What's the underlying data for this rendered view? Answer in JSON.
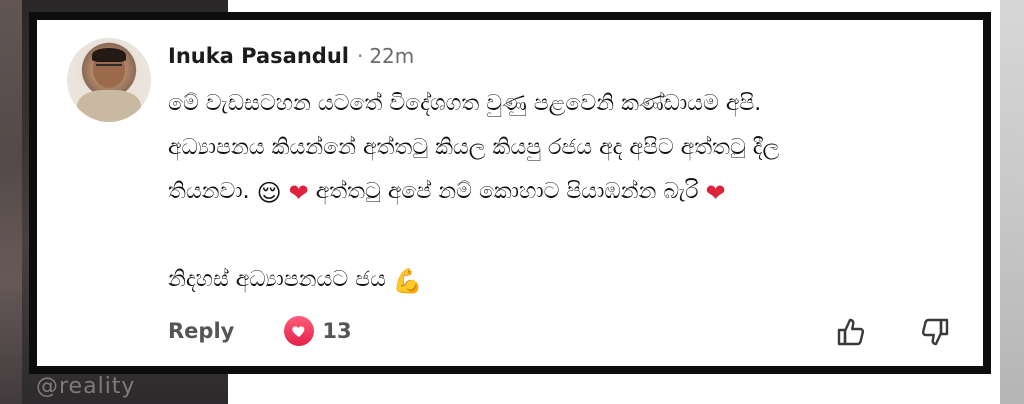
{
  "comment": {
    "author": "Inuka Pasandul",
    "separator": "·",
    "time": "22m",
    "lines": [
      "මේ වැඩසටහන යටතේ විදේශගත වුණු පළවෙනි කණ්ඩායම අපි.",
      "අධ්‍යාපනය කියන්නේ අත්තටු කියල කියපු රජය අද අපිට අත්තටු දීල"
    ],
    "line3_a": "තියනවා.",
    "line3_b": "අත්තටු අපේ නම් කොහාට පියාඹන්න බැරි",
    "line5": "නිදහස් අධ්‍යාපනයට ජය",
    "emojis": {
      "relieved": "😌",
      "heart": "❤",
      "flexed_biceps": "💪"
    },
    "reply_label": "Reply",
    "reaction_count": "13",
    "reaction_icon": "heart-reaction-icon"
  },
  "watermark": "@reality",
  "colors": {
    "reaction": "#e3224a",
    "border": "#0d0d0d"
  }
}
